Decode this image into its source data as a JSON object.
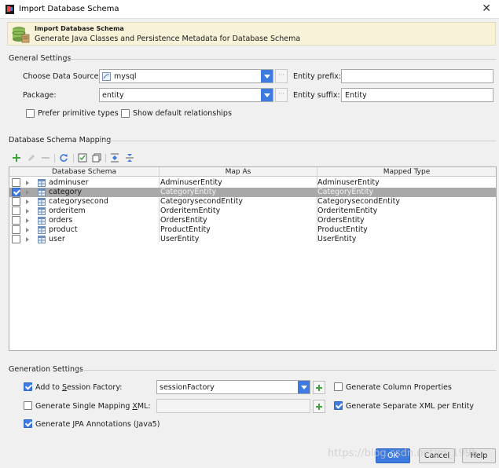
{
  "window": {
    "title": "Import Database Schema"
  },
  "banner": {
    "title": "Import Database Schema",
    "description": "Generate Java Classes and Persistence Metadata for Database Schema"
  },
  "general": {
    "section": "General Settings",
    "data_source_label": "Choose Data Source:",
    "data_source_value": "mysql",
    "entity_prefix_label": "Entity prefix:",
    "entity_prefix_value": "",
    "package_label": "Package:",
    "package_value": "entity",
    "entity_suffix_label": "Entity suffix:",
    "entity_suffix_value": "Entity",
    "prefer_primitive_label": "Prefer primitive types",
    "prefer_primitive_checked": false,
    "show_default_label": "Show default relationships",
    "show_default_checked": false
  },
  "mapping": {
    "section": "Database Schema Mapping",
    "columns": [
      "Database Schema",
      "Map As",
      "Mapped Type"
    ],
    "rows": [
      {
        "name": "adminuser",
        "map_as": "AdminuserEntity",
        "type": "AdminuserEntity",
        "checked": false,
        "selected": false
      },
      {
        "name": "category",
        "map_as": "CategoryEntity",
        "type": "CategoryEntity",
        "checked": true,
        "selected": true
      },
      {
        "name": "categorysecond",
        "map_as": "CategorysecondEntity",
        "type": "CategorysecondEntity",
        "checked": false,
        "selected": false
      },
      {
        "name": "orderitem",
        "map_as": "OrderitemEntity",
        "type": "OrderitemEntity",
        "checked": false,
        "selected": false
      },
      {
        "name": "orders",
        "map_as": "OrdersEntity",
        "type": "OrdersEntity",
        "checked": false,
        "selected": false
      },
      {
        "name": "product",
        "map_as": "ProductEntity",
        "type": "ProductEntity",
        "checked": false,
        "selected": false
      },
      {
        "name": "user",
        "map_as": "UserEntity",
        "type": "UserEntity",
        "checked": false,
        "selected": false
      }
    ]
  },
  "generation": {
    "section": "Generation Settings",
    "session_factory_label_pre": "Add to ",
    "session_factory_label_u": "S",
    "session_factory_label_post": "ession Factory:",
    "session_factory_checked": true,
    "session_factory_value": "sessionFactory",
    "gen_column_props_label": "Generate Column Properties",
    "gen_column_props_checked": false,
    "single_mapping_label_pre": "Generate Single Mapping ",
    "single_mapping_label_u": "X",
    "single_mapping_label_post": "ML:",
    "single_mapping_checked": false,
    "separate_xml_label": "Generate Separate XML per Entity",
    "separate_xml_checked": true,
    "jpa_label": "Generate JPA Annotations (Java5)",
    "jpa_checked": true
  },
  "buttons": {
    "ok": "OK",
    "cancel": "Cancel",
    "help": "Help"
  },
  "watermark": "https://blog.csdn.net/m_1996",
  "colors": {
    "accent": "#3d7be0",
    "selected_row": "#a8a8a8",
    "banner_bg": "#f8f3d8"
  }
}
